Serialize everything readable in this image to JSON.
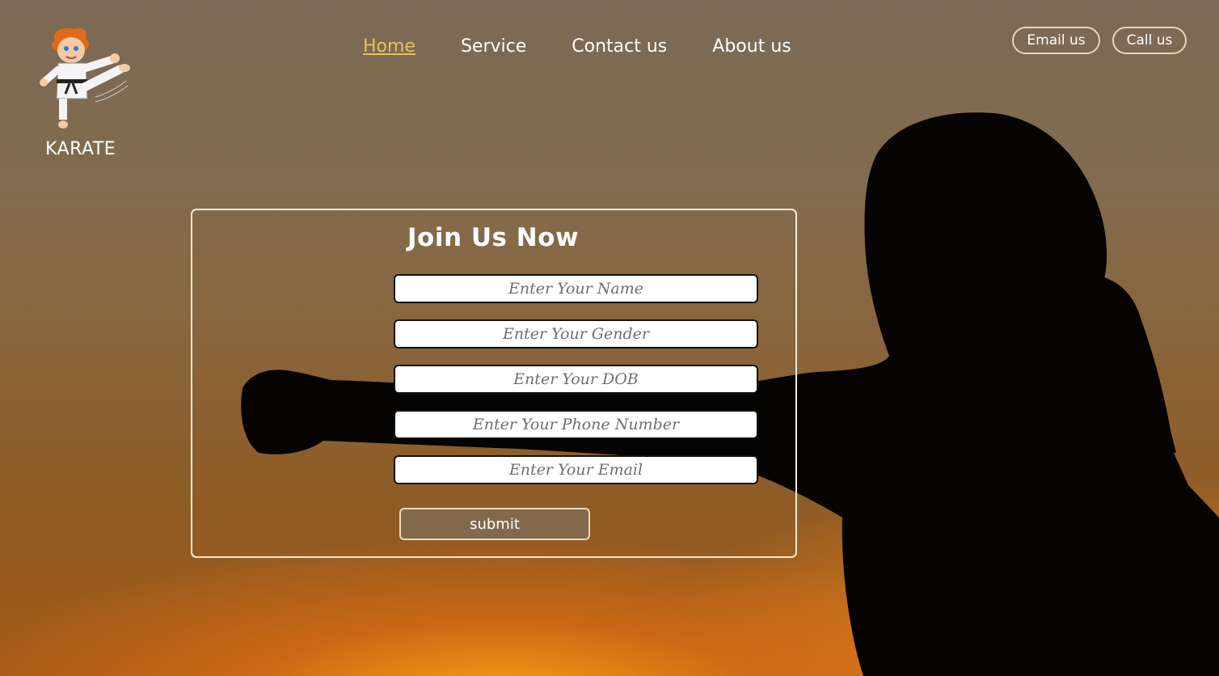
{
  "brand": {
    "name": "KARATE"
  },
  "nav": {
    "items": [
      {
        "label": "Home",
        "active": true
      },
      {
        "label": "Service",
        "active": false
      },
      {
        "label": "Contact us",
        "active": false
      },
      {
        "label": "About us",
        "active": false
      }
    ]
  },
  "contact": {
    "email_label": "Email us",
    "call_label": "Call us"
  },
  "form": {
    "title": "Join Us Now",
    "fields": [
      {
        "placeholder": "Enter Your Name",
        "value": ""
      },
      {
        "placeholder": "Enter Your Gender",
        "value": ""
      },
      {
        "placeholder": "Enter Your DOB",
        "value": ""
      },
      {
        "placeholder": "Enter Your Phone Number",
        "value": ""
      },
      {
        "placeholder": "Enter Your Email",
        "value": ""
      }
    ],
    "submit_label": "submit"
  },
  "colors": {
    "active_nav": "#e6c15a",
    "submit_bg": "#83694b",
    "border": "#f3ead8"
  },
  "icons": {
    "logo": "karate-kid-icon"
  }
}
